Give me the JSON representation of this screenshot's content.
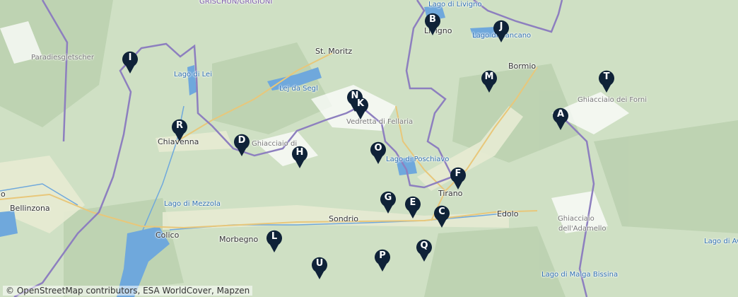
{
  "map": {
    "attribution": "© OpenStreetMap contributors, ESA WorldCover, Mapzen",
    "colors": {
      "land": "#cfe0c4",
      "valley": "#e9ecd6",
      "snow": "#ffffff",
      "water": "#6fa8dc",
      "border": "#8d7fbf",
      "road": "#e8c77a",
      "marker": "#0f2238"
    },
    "places": [
      {
        "id": "grischun",
        "text": "GRISCHUN/GRIGIONI",
        "kind": "region"
      },
      {
        "id": "paradies",
        "text": "Paradiesgletscher",
        "kind": "glacier"
      },
      {
        "id": "st-moritz",
        "text": "St. Moritz",
        "kind": "town"
      },
      {
        "id": "lago-livigno",
        "text": "Lago di Livigno",
        "kind": "water"
      },
      {
        "id": "livigno",
        "text": "Livigno",
        "kind": "town"
      },
      {
        "id": "lago-cancano",
        "text": "Lago di Cancano",
        "kind": "water"
      },
      {
        "id": "bormio",
        "text": "Bormio",
        "kind": "town"
      },
      {
        "id": "lago-lei",
        "text": "Lago di Lei",
        "kind": "water"
      },
      {
        "id": "lej-segl",
        "text": "Lej da Segl",
        "kind": "water"
      },
      {
        "id": "ghiacciaio-forni",
        "text": "Ghiacciaio dei Forni",
        "kind": "glacier"
      },
      {
        "id": "vedretta",
        "text": "Vedretta di Fellaria",
        "kind": "glacier"
      },
      {
        "id": "chiavenna",
        "text": "Chiavenna",
        "kind": "town"
      },
      {
        "id": "ghiacciaio-disgrazia",
        "text": "Ghiacciaio di",
        "kind": "glacier"
      },
      {
        "id": "lago-poschiavo",
        "text": "Lago di Poschiavo",
        "kind": "water"
      },
      {
        "id": "tirano",
        "text": "Tirano",
        "kind": "town"
      },
      {
        "id": "bellinzona",
        "text": "Bellinzona",
        "kind": "town"
      },
      {
        "id": "lago-mezzola",
        "text": "Lago di Mezzola",
        "kind": "water"
      },
      {
        "id": "sondrio",
        "text": "Sondrio",
        "kind": "town"
      },
      {
        "id": "edolo",
        "text": "Edolo",
        "kind": "town"
      },
      {
        "id": "ghiacciaio-adamello",
        "text": "Ghiacciaio",
        "kind": "glacier"
      },
      {
        "id": "adamello",
        "text": "dell'Adamello",
        "kind": "glacier"
      },
      {
        "id": "colico",
        "text": "Colico",
        "kind": "town"
      },
      {
        "id": "morbegno",
        "text": "Morbegno",
        "kind": "town"
      },
      {
        "id": "lago-avio",
        "text": "Lago di Avio",
        "kind": "water"
      },
      {
        "id": "lago-malga",
        "text": "Lago di Malga Bissina",
        "kind": "water"
      },
      {
        "id": "edge-o",
        "text": "o",
        "kind": "town"
      }
    ],
    "markers": [
      "A",
      "B",
      "C",
      "D",
      "E",
      "G",
      "H",
      "I",
      "J",
      "K",
      "L",
      "M",
      "N",
      "O",
      "P",
      "Q",
      "R",
      "T",
      "U"
    ]
  }
}
